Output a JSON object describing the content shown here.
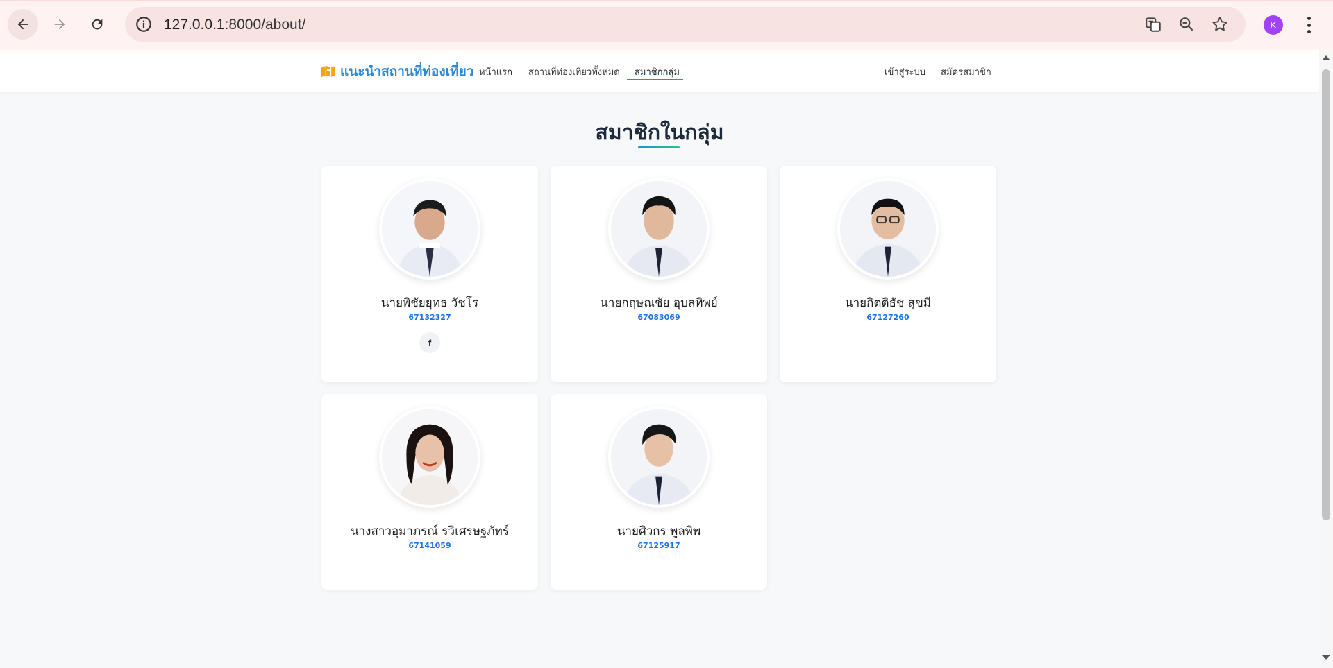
{
  "browser": {
    "url_host": "127.0.0.1",
    "url_rest": ":8000/about/",
    "profile_initial": "K"
  },
  "nav": {
    "brand": "แนะนำสถานที่ท่องเที่ยว",
    "links": [
      "หน้าแรก",
      "สถานที่ท่องเที่ยวทั้งหมด",
      "สมาชิกกลุ่ม"
    ],
    "active": "สมาชิกกลุ่ม",
    "auth": [
      "เข้าสู่ระบบ",
      "สมัครสมาชิก"
    ]
  },
  "page": {
    "title": "สมาชิกในกลุ่ม"
  },
  "members": [
    {
      "name": "นายพิชัยยุทธ วัชโร",
      "id": "67132327",
      "facebook_icon": "f"
    },
    {
      "name": "นายกฤษณชัย อุบลทิพย์",
      "id": "67083069"
    },
    {
      "name": "นายกิตติธัช สุขมี",
      "id": "67127260"
    },
    {
      "name": "นางสาวอุมาภรณ์ รวิเศรษฐภัทร์",
      "id": "67141059"
    },
    {
      "name": "นายศิวกร พูลพิพ",
      "id": "67125917"
    }
  ],
  "colors": {
    "accent": "#2a8bd0",
    "id_blue": "#1a73e8",
    "page_bg": "#f7f8fa",
    "chrome_bg": "#fff2f2"
  }
}
